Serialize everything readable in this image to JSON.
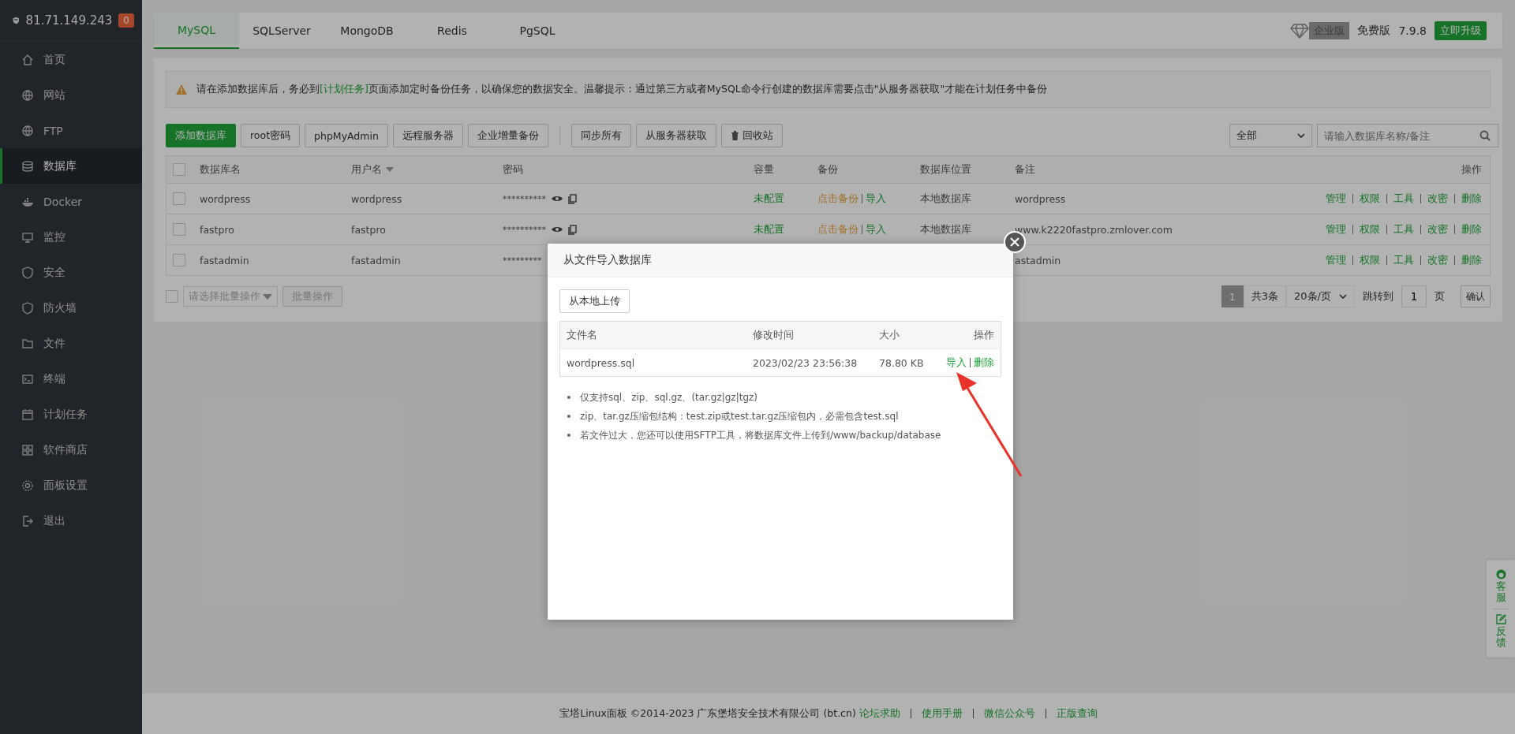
{
  "sidebar": {
    "host": "81.71.149.243",
    "badge": "0",
    "items": [
      {
        "label": "首页",
        "selected": false
      },
      {
        "label": "网站",
        "selected": false
      },
      {
        "label": "FTP",
        "selected": false
      },
      {
        "label": "数据库",
        "selected": true
      },
      {
        "label": "Docker",
        "selected": false
      },
      {
        "label": "监控",
        "selected": false
      },
      {
        "label": "安全",
        "selected": false
      },
      {
        "label": "防火墙",
        "selected": false
      },
      {
        "label": "文件",
        "selected": false
      },
      {
        "label": "终端",
        "selected": false
      },
      {
        "label": "计划任务",
        "selected": false
      },
      {
        "label": "软件商店",
        "selected": false
      },
      {
        "label": "面板设置",
        "selected": false
      },
      {
        "label": "退出",
        "selected": false
      }
    ]
  },
  "tabs": [
    {
      "label": "MySQL",
      "selected": true
    },
    {
      "label": "SQLServer",
      "selected": false
    },
    {
      "label": "MongoDB",
      "selected": false
    },
    {
      "label": "Redis",
      "selected": false
    },
    {
      "label": "PgSQL",
      "selected": false
    }
  ],
  "version": {
    "edition_tag": "企业版",
    "edition": "免费版",
    "number": "7.9.8",
    "upgrade": "立即升级"
  },
  "alert": {
    "before": "请在添加数据库后，务必到",
    "link": "[计划任务]",
    "after": "页面添加定时备份任务，以确保您的数据安全。温馨提示：通过第三方或者MySQL命令行创建的数据库需要点击\"从服务器获取\"才能在计划任务中备份"
  },
  "toolbar": {
    "buttons": [
      {
        "label": "添加数据库",
        "kind": "primary"
      },
      {
        "label": "root密码",
        "kind": "plain"
      },
      {
        "label": "phpMyAdmin",
        "kind": "plain"
      },
      {
        "label": "远程服务器",
        "kind": "plain"
      },
      {
        "label": "企业增量备份",
        "kind": "plain"
      },
      {
        "label": "同步所有",
        "kind": "plain"
      },
      {
        "label": "从服务器获取",
        "kind": "plain"
      },
      {
        "label": "回收站",
        "kind": "trash"
      }
    ],
    "filter": "全部",
    "search_placeholder": "请输入数据库名称/备注"
  },
  "table": {
    "select_all_checked": false,
    "columns": [
      "数据库名",
      "用户名",
      "密码",
      "容量",
      "备份",
      "数据库位置",
      "备注",
      "操作"
    ],
    "rows": [
      {
        "checked": false,
        "name": "wordpress",
        "user": "wordpress",
        "password": "**********",
        "capacity": "未配置",
        "backup": "点击备份",
        "import": "导入",
        "location": "本地数据库",
        "note": "wordpress",
        "actions": [
          "管理",
          "权限",
          "工具",
          "改密",
          "删除"
        ]
      },
      {
        "checked": false,
        "name": "fastpro",
        "user": "fastpro",
        "password": "**********",
        "capacity": "未配置",
        "backup": "点击备份",
        "import": "导入",
        "location": "本地数据库",
        "note": "www.k2220fastpro.zmlover.com",
        "actions": [
          "管理",
          "权限",
          "工具",
          "改密",
          "删除"
        ]
      },
      {
        "checked": false,
        "name": "fastadmin",
        "user": "fastadmin",
        "password": "*********",
        "note": "astadmin",
        "actions": [
          "管理",
          "权限",
          "工具",
          "改密",
          "删除"
        ]
      }
    ]
  },
  "batch": {
    "checked": false,
    "placeholder": "请选择批量操作",
    "button": "批量操作",
    "disabled": true
  },
  "pagination": {
    "pages": [
      {
        "label": "1",
        "selected": true
      }
    ],
    "total": "共3条",
    "per_page": "20条/页",
    "jump_label": "跳转到",
    "jump_value": "1",
    "page_unit": "页",
    "confirm": "确认"
  },
  "modal": {
    "title": "从文件导入数据库",
    "upload": "从本地上传",
    "columns": [
      "文件名",
      "修改时间",
      "大小",
      "操作"
    ],
    "files": [
      {
        "name": "wordpress.sql",
        "modified": "2023/02/23 23:56:38",
        "size": "78.80 KB",
        "actions": [
          "导入",
          "删除"
        ]
      }
    ],
    "notes": [
      "仅支持sql、zip、sql.gz、(tar.gz|gz|tgz)",
      "zip、tar.gz压缩包结构：test.zip或test.tar.gz压缩包内，必需包含test.sql",
      "若文件过大，您还可以使用SFTP工具，将数据库文件上传到/www/backup/database"
    ]
  },
  "float_panel": [
    {
      "label": "客服",
      "kind": "support"
    },
    {
      "label": "反馈",
      "kind": "feedback"
    }
  ],
  "footer": {
    "text": "宝塔Linux面板 ©2014-2023 广东堡塔安全技术有限公司 (bt.cn)",
    "links": [
      "论坛求助",
      "使用手册",
      "微信公众号",
      "正版查询"
    ]
  }
}
